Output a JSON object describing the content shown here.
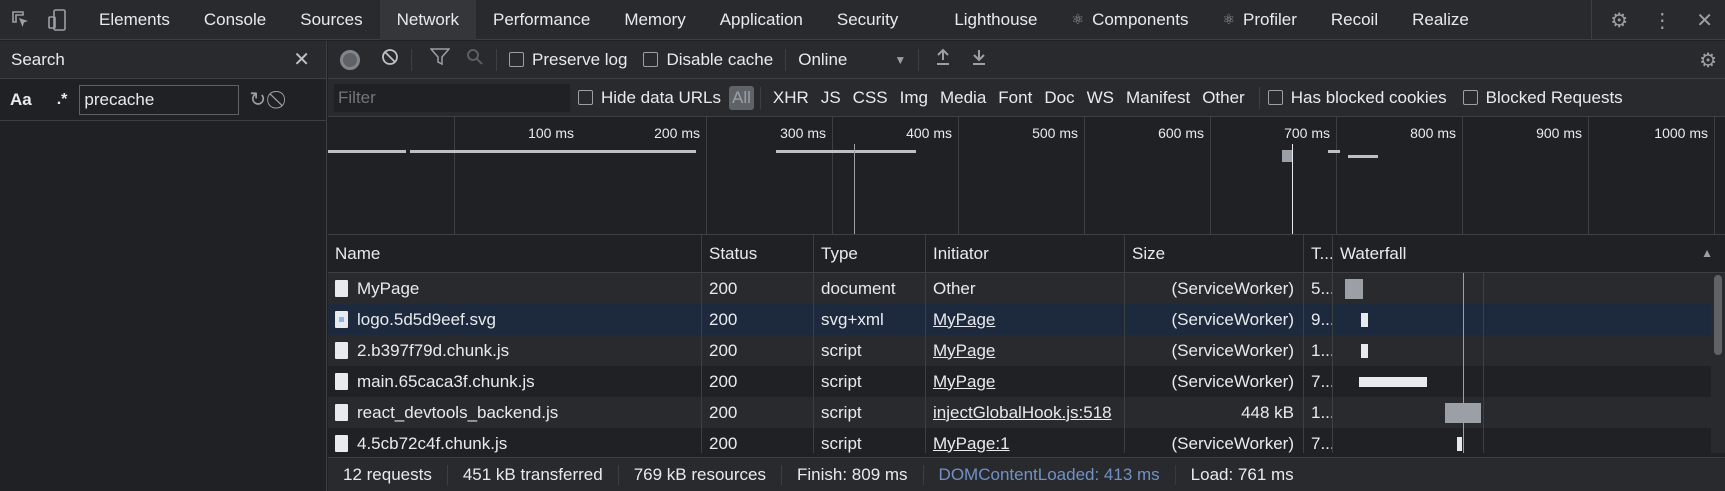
{
  "tabs": [
    {
      "label": "Elements",
      "name": "tab-elements"
    },
    {
      "label": "Console",
      "name": "tab-console"
    },
    {
      "label": "Sources",
      "name": "tab-sources"
    },
    {
      "label": "Network",
      "name": "tab-network",
      "active": true
    },
    {
      "label": "Performance",
      "name": "tab-performance"
    },
    {
      "label": "Memory",
      "name": "tab-memory"
    },
    {
      "label": "Application",
      "name": "tab-application"
    },
    {
      "label": "Security",
      "name": "tab-security"
    },
    {
      "label": "Lighthouse",
      "name": "tab-lighthouse"
    },
    {
      "label": "Components",
      "name": "tab-components",
      "icon": "react-icon"
    },
    {
      "label": "Profiler",
      "name": "tab-profiler",
      "icon": "react-icon"
    },
    {
      "label": "Recoil",
      "name": "tab-recoil"
    },
    {
      "label": "Realize",
      "name": "tab-realize"
    }
  ],
  "search_panel": {
    "title": "Search",
    "case_label": "Aa",
    "regex_label": ".*",
    "query": "precache"
  },
  "toolbar": {
    "preserve_log": "Preserve log",
    "disable_cache": "Disable cache",
    "throttle": "Online"
  },
  "filter_bar": {
    "placeholder": "Filter",
    "hide_data_urls": "Hide data URLs",
    "types": [
      "All",
      "XHR",
      "JS",
      "CSS",
      "Img",
      "Media",
      "Font",
      "Doc",
      "WS",
      "Manifest",
      "Other"
    ],
    "has_blocked_cookies": "Has blocked cookies",
    "blocked_requests": "Blocked Requests"
  },
  "overview": {
    "tick_labels": [
      "100 ms",
      "200 ms",
      "300 ms",
      "400 ms",
      "500 ms",
      "600 ms",
      "700 ms",
      "800 ms",
      "900 ms",
      "1000 ms"
    ]
  },
  "table": {
    "columns": {
      "name": "Name",
      "status": "Status",
      "type": "Type",
      "initiator": "Initiator",
      "size": "Size",
      "time": "T...",
      "waterfall": "Waterfall"
    },
    "rows": [
      {
        "name": "MyPage",
        "status": "200",
        "type": "document",
        "initiator": "Other",
        "initiator_link": false,
        "size": "(ServiceWorker)",
        "time": "5...",
        "icon": "document-icon"
      },
      {
        "name": "logo.5d5d9eef.svg",
        "status": "200",
        "type": "svg+xml",
        "initiator": "MyPage",
        "initiator_link": true,
        "size": "(ServiceWorker)",
        "time": "9...",
        "icon": "image-icon"
      },
      {
        "name": "2.b397f79d.chunk.js",
        "status": "200",
        "type": "script",
        "initiator": "MyPage",
        "initiator_link": true,
        "size": "(ServiceWorker)",
        "time": "1...",
        "icon": "document-icon"
      },
      {
        "name": "main.65caca3f.chunk.js",
        "status": "200",
        "type": "script",
        "initiator": "MyPage",
        "initiator_link": true,
        "size": "(ServiceWorker)",
        "time": "7...",
        "icon": "document-icon"
      },
      {
        "name": "react_devtools_backend.js",
        "status": "200",
        "type": "script",
        "initiator": "injectGlobalHook.js:518",
        "initiator_link": true,
        "size": "448 kB",
        "time": "1...",
        "icon": "document-icon"
      },
      {
        "name": "4.5cb72c4f.chunk.js",
        "status": "200",
        "type": "script",
        "initiator": "MyPage:1",
        "initiator_link": true,
        "size": "(ServiceWorker)",
        "time": "7...",
        "icon": "document-icon"
      }
    ]
  },
  "status_bar": {
    "requests": "12 requests",
    "transferred": "451 kB transferred",
    "resources": "769 kB resources",
    "finish": "Finish: 809 ms",
    "dom_content_loaded": "DOMContentLoaded: 413 ms",
    "load": "Load: 761 ms"
  },
  "colors": {
    "background": "#202124",
    "toolbar": "#292a2d",
    "selected_row": "#1d2a3d",
    "dcl_blue": "#8ab4f8"
  }
}
